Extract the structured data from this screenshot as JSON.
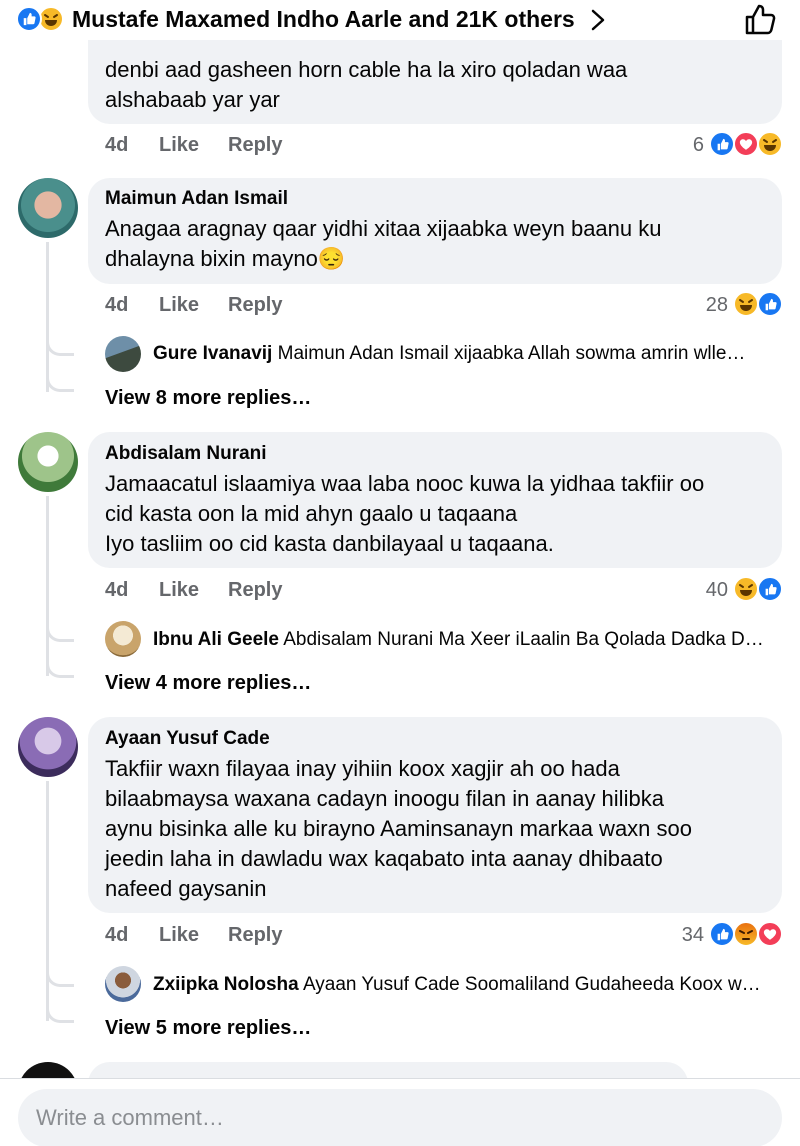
{
  "header": {
    "reactions_summary": "Mustafe Maxamed Indho Aarle and 21K others",
    "reaction_icons": [
      "like-icon",
      "haha-icon"
    ],
    "like_button_icon": "thumbs-up-outline-icon"
  },
  "colors": {
    "like_blue": "#1877f2",
    "love_red": "#f33e58",
    "haha_yellow": "#f7b928",
    "angry_orange": "#e9710f",
    "bubble_bg": "#f0f2f5",
    "meta_gray": "#65676b"
  },
  "comments": [
    {
      "author": "",
      "lines": [
        "denbi aad gasheen horn cable ha la xiro qoladan waa",
        "alshabaab yar yar"
      ],
      "time": "4d",
      "like": "Like",
      "reply": "Reply",
      "reaction_count": "6",
      "reactions": [
        "like",
        "love",
        "haha"
      ]
    },
    {
      "author": "Maimun Adan Ismail",
      "lines": [
        "Anagaa aragnay qaar yidhi xitaa xijaabka weyn baanu ku",
        "dhalayna bixin mayno😔"
      ],
      "time": "4d",
      "like": "Like",
      "reply": "Reply",
      "reaction_count": "28",
      "reactions": [
        "haha",
        "like"
      ],
      "reply_preview": {
        "author": "Gure Ivanavij",
        "text": "Maimun Adan Ismail xijaabka Allah sowma amrin wlle…"
      },
      "more_replies": "View 8 more replies…"
    },
    {
      "author": "Abdisalam Nurani",
      "lines": [
        "Jamaacatul islaamiya waa laba nooc kuwa la yidhaa takfiir oo",
        "cid kasta oon la mid ahyn gaalo u taqaana",
        "Iyo tasliim oo cid kasta danbilayaal u taqaana."
      ],
      "time": "4d",
      "like": "Like",
      "reply": "Reply",
      "reaction_count": "40",
      "reactions": [
        "haha",
        "like"
      ],
      "reply_preview": {
        "author": "Ibnu Ali Geele",
        "text": "Abdisalam Nurani Ma Xeer iLaalin Ba Qolada Dadka D…"
      },
      "more_replies": "View 4 more replies…"
    },
    {
      "author": "Ayaan Yusuf Cade",
      "lines": [
        "Takfiir waxn filayaa inay yihiin koox xagjir ah oo hada",
        "bilaabmaysa waxana cadayn inoogu filan in aanay hilibka",
        "aynu bisinka alle ku birayno Aaminsanayn markaa waxn soo",
        "jeedin laha in dawladu wax kaqabato inta aanay dhibaato",
        "nafeed gaysanin"
      ],
      "time": "4d",
      "like": "Like",
      "reply": "Reply",
      "reaction_count": "34",
      "reactions": [
        "like",
        "angry",
        "love"
      ],
      "reply_preview": {
        "author": "Zxiipka Nolosha",
        "text": "Ayaan Yusuf Cade Soomaliland Gudaheeda Koox w…"
      },
      "more_replies": "View 5 more replies…"
    }
  ],
  "composer": {
    "placeholder": "Write a comment…"
  }
}
